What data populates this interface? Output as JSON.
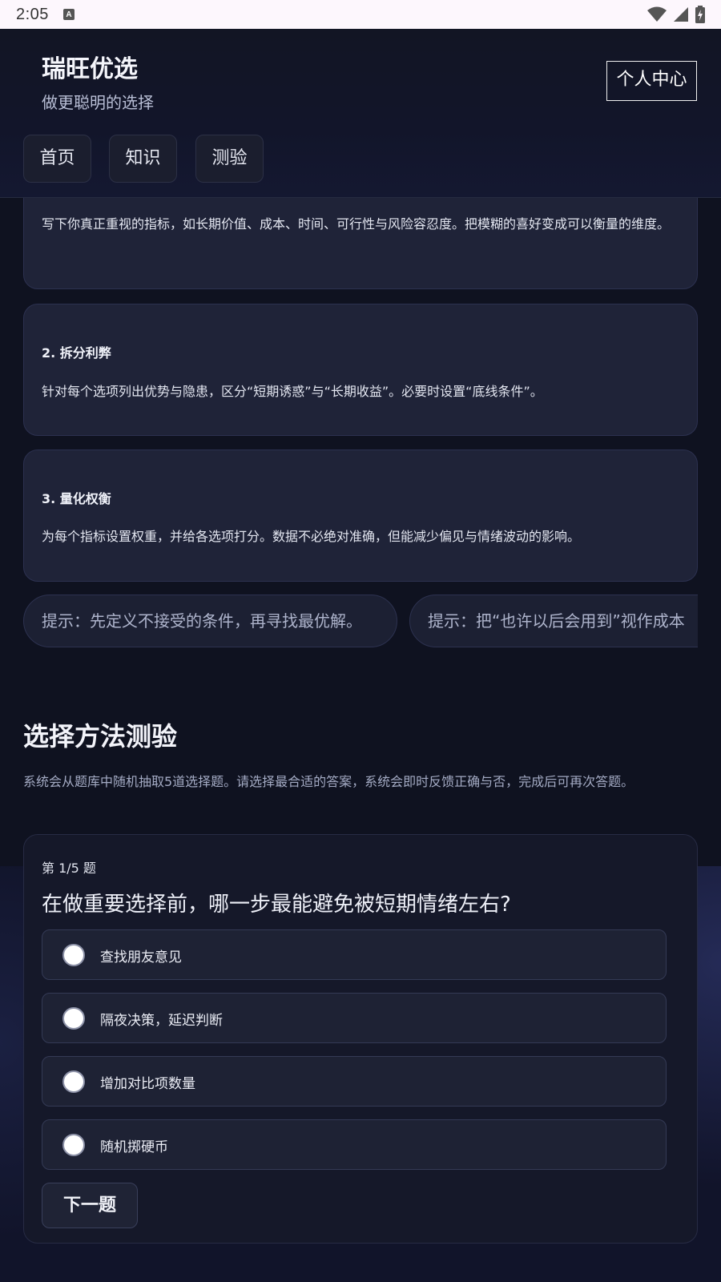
{
  "status_bar": {
    "time": "2:05",
    "notification_icon": "A"
  },
  "header": {
    "brand_title": "瑞旺优选",
    "brand_subtitle": "做更聪明的选择",
    "profile_label": "个人中心",
    "nav": [
      "首页",
      "知识",
      "测验"
    ]
  },
  "steps": [
    {
      "title": "",
      "body": "写下你真正重视的指标，如长期价值、成本、时间、可行性与风险容忍度。把模糊的喜好变成可以衡量的维度。"
    },
    {
      "title": "2. 拆分利弊",
      "body": "针对每个选项列出优势与隐患，区分“短期诱惑”与“长期收益”。必要时设置“底线条件”。"
    },
    {
      "title": "3. 量化权衡",
      "body": "为每个指标设置权重，并给各选项打分。数据不必绝对准确，但能减少偏见与情绪波动的影响。"
    }
  ],
  "tips": [
    "提示：先定义不接受的条件，再寻找最优解。",
    "提示：把“也许以后会用到”视作成本"
  ],
  "quiz_section": {
    "title": "选择方法测验",
    "description": "系统会从题库中随机抽取5道选择题。请选择最合适的答案，系统会即时反馈正确与否，完成后可再次答题。"
  },
  "quiz": {
    "progress": "第 1/5 题",
    "question": "在做重要选择前，哪一步最能避免被短期情绪左右?",
    "options": [
      "查找朋友意见",
      "隔夜决策，延迟判断",
      "增加对比项数量",
      "随机掷硬币"
    ],
    "next_label": "下一题"
  }
}
